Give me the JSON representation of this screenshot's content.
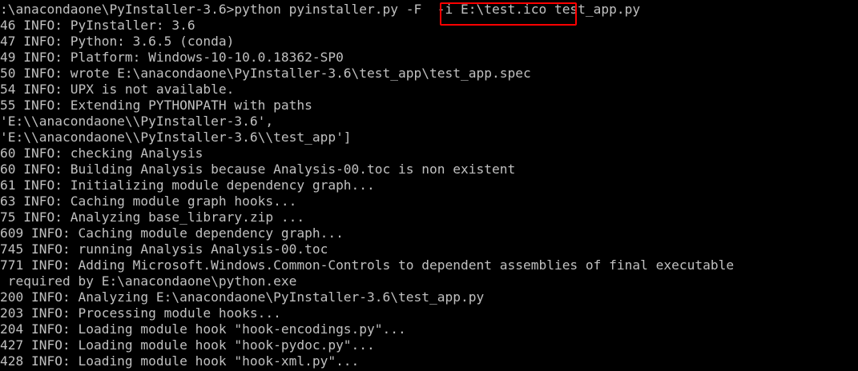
{
  "console": {
    "lines": [
      ":\\anacondaone\\PyInstaller-3.6>python pyinstaller.py -F  -i E:\\test.ico test_app.py",
      "46 INFO: PyInstaller: 3.6",
      "47 INFO: Python: 3.6.5 (conda)",
      "49 INFO: Platform: Windows-10-10.0.18362-SP0",
      "50 INFO: wrote E:\\anacondaone\\PyInstaller-3.6\\test_app\\test_app.spec",
      "54 INFO: UPX is not available.",
      "55 INFO: Extending PYTHONPATH with paths",
      "'E:\\\\anacondaone\\\\PyInstaller-3.6',",
      "'E:\\\\anacondaone\\\\PyInstaller-3.6\\\\test_app']",
      "60 INFO: checking Analysis",
      "60 INFO: Building Analysis because Analysis-00.toc is non existent",
      "61 INFO: Initializing module dependency graph...",
      "63 INFO: Caching module graph hooks...",
      "75 INFO: Analyzing base_library.zip ...",
      "609 INFO: Caching module dependency graph...",
      "745 INFO: running Analysis Analysis-00.toc",
      "771 INFO: Adding Microsoft.Windows.Common-Controls to dependent assemblies of final executable",
      " required by E:\\anacondaone\\python.exe",
      "200 INFO: Analyzing E:\\anacondaone\\PyInstaller-3.6\\test_app.py",
      "203 INFO: Processing module hooks...",
      "204 INFO: Loading module hook \"hook-encodings.py\"...",
      "427 INFO: Loading module hook \"hook-pydoc.py\"...",
      "428 INFO: Loading module hook \"hook-xml.py\"..."
    ]
  },
  "colors": {
    "background": "#000000",
    "text": "#c0c0c0",
    "highlight_border": "#ff0000"
  }
}
